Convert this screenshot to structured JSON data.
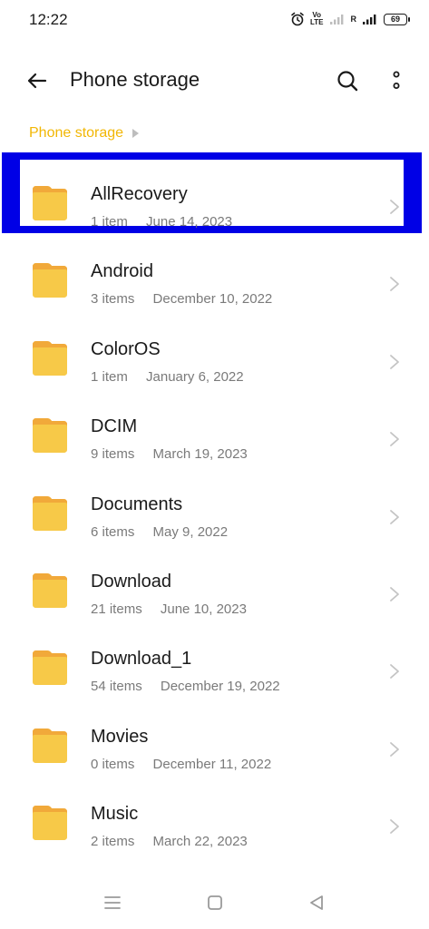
{
  "status_bar": {
    "time": "12:22",
    "volte_top": "Vo",
    "volte_bottom": "LTE",
    "roaming_label": "R",
    "battery": "69"
  },
  "header": {
    "title": "Phone storage"
  },
  "breadcrumb": {
    "items": [
      "Phone storage"
    ]
  },
  "colors": {
    "accent": "#f2b705",
    "folder": "#f7c948",
    "folder_tab": "#f1a93a",
    "highlight": "#0000e6",
    "meta_text": "#7a7a7a"
  },
  "icons": {
    "back": "arrow-left-icon",
    "search": "search-icon",
    "more": "more-vertical-icon",
    "folder": "folder-icon",
    "chevron": "chevron-right-icon"
  },
  "files": [
    {
      "name": "AllRecovery",
      "count": "1 item",
      "date": "June 14, 2023",
      "highlighted": true
    },
    {
      "name": "Android",
      "count": "3 items",
      "date": "December 10, 2022",
      "highlighted": false
    },
    {
      "name": "ColorOS",
      "count": "1 item",
      "date": "January 6, 2022",
      "highlighted": false
    },
    {
      "name": "DCIM",
      "count": "9 items",
      "date": "March 19, 2023",
      "highlighted": false
    },
    {
      "name": "Documents",
      "count": "6 items",
      "date": "May 9, 2022",
      "highlighted": false
    },
    {
      "name": "Download",
      "count": "21 items",
      "date": "June 10, 2023",
      "highlighted": false
    },
    {
      "name": "Download_1",
      "count": "54 items",
      "date": "December 19, 2022",
      "highlighted": false
    },
    {
      "name": "Movies",
      "count": "0 items",
      "date": "December 11, 2022",
      "highlighted": false
    },
    {
      "name": "Music",
      "count": "2 items",
      "date": "March 22, 2023",
      "highlighted": false
    }
  ]
}
